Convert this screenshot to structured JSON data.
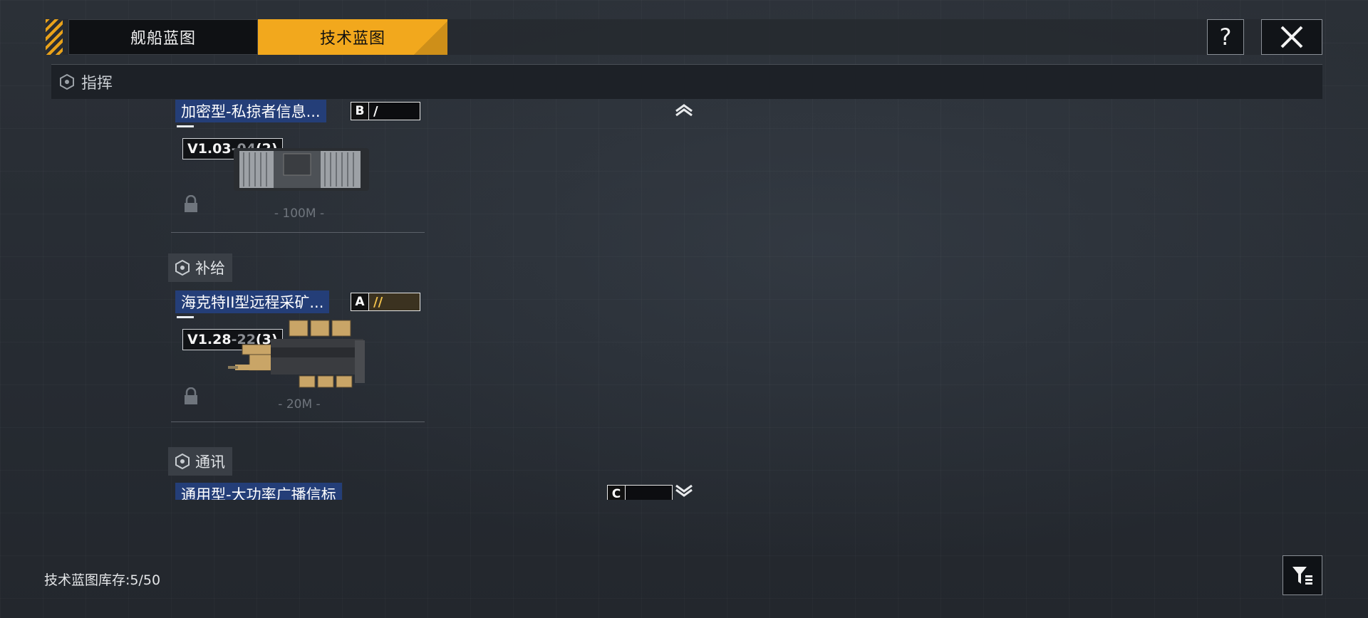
{
  "tabs": {
    "ship_blueprint": "舰船蓝图",
    "tech_blueprint": "技术蓝图"
  },
  "icons": {
    "help": "question-mark-icon",
    "close": "close-x-icon",
    "filter": "filter-icon"
  },
  "sections": {
    "command": "指挥",
    "supply": "补给",
    "comms": "通讯"
  },
  "cards": [
    {
      "title": "加密型-私掠者信息...",
      "grade": "B",
      "grade_bars": "/",
      "version_main": "V1.03",
      "version_dim": "-04",
      "version_count": "(2)",
      "range": "- 100M -"
    },
    {
      "title": "海克特II型远程采矿...",
      "grade": "A",
      "grade_bars": "//",
      "version_main": "V1.28",
      "version_dim": "-22",
      "version_count": "(3)",
      "range": "- 20M -"
    },
    {
      "title": "通用型-大功率广播信标",
      "grade": "C",
      "grade_bars": ""
    }
  ],
  "footer": {
    "inventory": "技术蓝图库存:5/50"
  },
  "colors": {
    "accent": "#f2a81d",
    "title_bg": "#243e78",
    "grade_a": "#f2c24b"
  }
}
